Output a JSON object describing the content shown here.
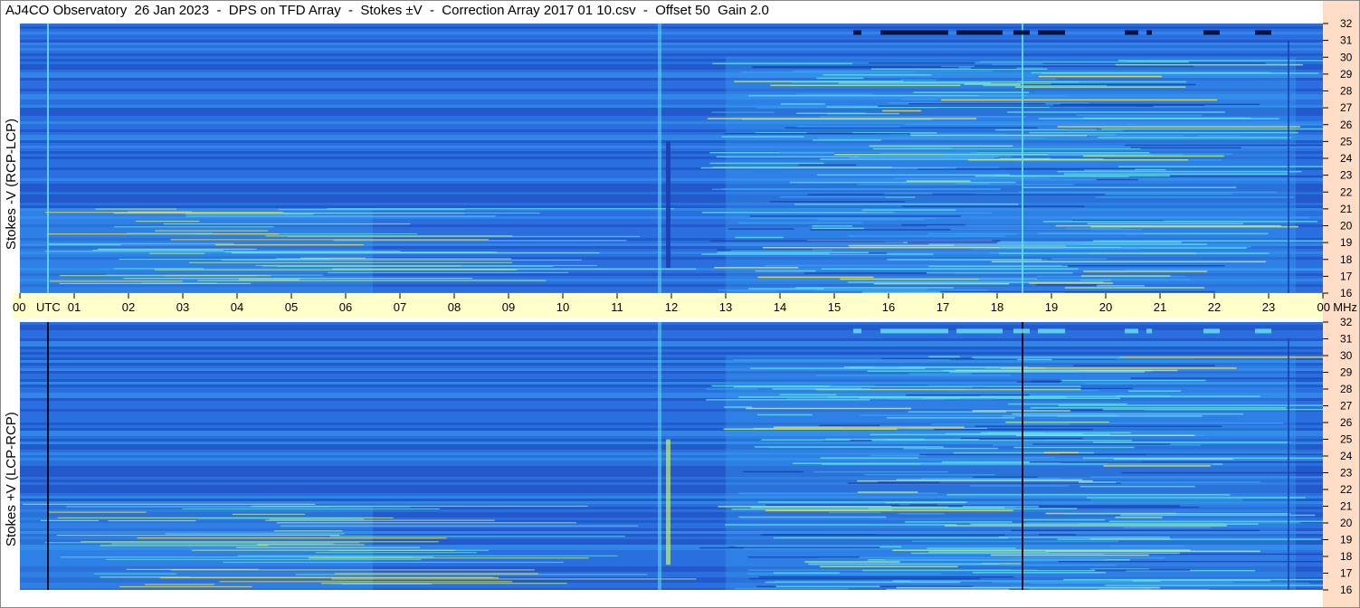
{
  "title": "AJ4CO Observatory  26 Jan 2023  -  DPS on TFD Array  -  Stokes ±V  -  Correction Array 2017 01 10.csv  -  Offset 50  Gain 2.0",
  "chart_data": [
    {
      "type": "heatmap",
      "ylabel": "Stokes -V (RCP-LCP)",
      "x_ticks": [
        "00",
        "01",
        "02",
        "03",
        "04",
        "05",
        "06",
        "07",
        "08",
        "09",
        "10",
        "11",
        "12",
        "13",
        "14",
        "15",
        "16",
        "17",
        "18",
        "19",
        "20",
        "21",
        "22",
        "23",
        "00"
      ],
      "x_unit": "UTC",
      "y_ticks": [
        16,
        17,
        18,
        19,
        20,
        21,
        22,
        23,
        24,
        25,
        26,
        27,
        28,
        29,
        30,
        31,
        32
      ],
      "y_unit": "MHz",
      "xlim": [
        0,
        24
      ],
      "ylim": [
        16,
        32
      ],
      "colormap": [
        "#1a3fb0",
        "#2a6fe0",
        "#3aa0f0",
        "#60e0e8",
        "#c0f080",
        "#ffe040",
        "#ff6020"
      ]
    },
    {
      "type": "heatmap",
      "ylabel": "Stokes +V (LCP-RCP)",
      "x_ticks": [
        "00",
        "01",
        "02",
        "03",
        "04",
        "05",
        "06",
        "07",
        "08",
        "09",
        "10",
        "11",
        "12",
        "13",
        "14",
        "15",
        "16",
        "17",
        "18",
        "19",
        "20",
        "21",
        "22",
        "23",
        "00"
      ],
      "x_unit": "UTC",
      "y_ticks": [
        16,
        17,
        18,
        19,
        20,
        21,
        22,
        23,
        24,
        25,
        26,
        27,
        28,
        29,
        30,
        31,
        32
      ],
      "y_unit": "MHz",
      "xlim": [
        0,
        24
      ],
      "ylim": [
        16,
        32
      ],
      "colormap": [
        "#1a3fb0",
        "#2a6fe0",
        "#3aa0f0",
        "#60e0e8",
        "#c0f080",
        "#ffe040",
        "#ff6020"
      ]
    }
  ]
}
